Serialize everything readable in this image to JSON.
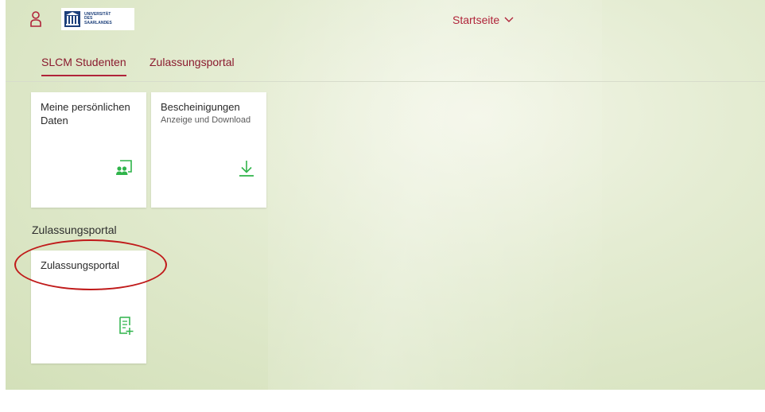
{
  "shell": {
    "logo_text": [
      "UNIVERSITÄT",
      "DES",
      "SAARLANDES"
    ],
    "title_menu_label": "Startseite",
    "accent_color": "#b0243a",
    "icon_color": "#2fb44a"
  },
  "tabs": [
    {
      "label": "SLCM Studenten",
      "active": true
    },
    {
      "label": "Zulassungsportal",
      "active": false
    }
  ],
  "tiles": {
    "personal": {
      "title_line1": "Meine persönlichen",
      "title_line2": "Daten",
      "icon": "people-icon"
    },
    "certificates": {
      "title": "Bescheinigungen",
      "subtitle": "Anzeige und Download",
      "icon": "download-icon"
    },
    "admission": {
      "title": "Zulassungsportal",
      "icon": "document-add-icon"
    }
  },
  "groups": {
    "admission_title": "Zulassungsportal"
  }
}
